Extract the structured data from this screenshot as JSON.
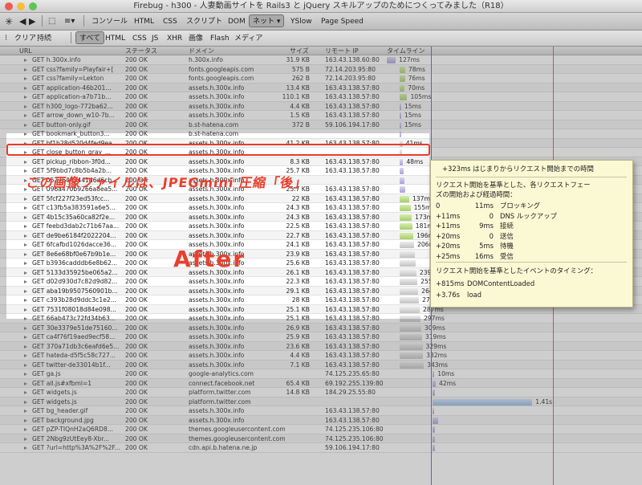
{
  "window": {
    "title": "Firebug - h300 - 人妻動画サイトを Rails3 と jQuery スキルアップのためにつくってみました（R18）"
  },
  "toolbar": {
    "tabs": [
      "コンソール",
      "HTML",
      "CSS",
      "スクリプト",
      "DOM",
      "ネット",
      "YSlow",
      "Page Speed"
    ],
    "net_dropdown": "▾",
    "clear": "クリア",
    "persist": "持続",
    "filters": [
      "すべて",
      "HTML",
      "CSS",
      "JS",
      "XHR",
      "画像",
      "Flash",
      "メディア"
    ]
  },
  "columns": {
    "url": "URL",
    "status": "ステータス",
    "domain": "ドメイン",
    "size": "サイズ",
    "remote_ip": "リモート IP",
    "timeline": "タイムライン"
  },
  "requests": [
    {
      "url": "GET h.300x.info",
      "status": "200 OK",
      "domain": "h.300x.info",
      "size": "31.9 KB",
      "ip": "163.43.138.60:80",
      "ms": "127ms",
      "bar_start": 0,
      "bar_len": 0.035,
      "color": "p"
    },
    {
      "url": "GET css?family=Playfair+[",
      "status": "200 OK",
      "domain": "fonts.googleapis.com",
      "size": "575 B",
      "ip": "72.14.203.95:80",
      "ms": "78ms",
      "bar_start": 0.05,
      "bar_len": 0.022,
      "color": "g"
    },
    {
      "url": "GET css?family=Lekton",
      "status": "200 OK",
      "domain": "fonts.googleapis.com",
      "size": "262 B",
      "ip": "72.14.203.95:80",
      "ms": "76ms",
      "bar_start": 0.05,
      "bar_len": 0.021,
      "color": "g"
    },
    {
      "url": "GET application-46b201...",
      "status": "200 OK",
      "domain": "assets.h.300x.info",
      "size": "13.4 KB",
      "ip": "163.43.138.57:80",
      "ms": "70ms",
      "bar_start": 0.05,
      "bar_len": 0.02,
      "color": "g"
    },
    {
      "url": "GET application-a7b71b...",
      "status": "200 OK",
      "domain": "assets.h.300x.info",
      "size": "110.1 KB",
      "ip": "163.43.138.57:80",
      "ms": "105ms",
      "bar_start": 0.05,
      "bar_len": 0.03,
      "color": "g"
    },
    {
      "url": "GET h300_logo-772ba62...",
      "status": "200 OK",
      "domain": "assets.h.300x.info",
      "size": "4.4 KB",
      "ip": "163.43.138.57:80",
      "ms": "15ms",
      "bar_start": 0.05,
      "bar_len": 0.004,
      "color": "p"
    },
    {
      "url": "GET arrow_down_w10-7b...",
      "status": "200 OK",
      "domain": "assets.h.300x.info",
      "size": "1.5 KB",
      "ip": "163.43.138.57:80",
      "ms": "15ms",
      "bar_start": 0.05,
      "bar_len": 0.004,
      "color": "p"
    },
    {
      "url": "GET button-only.gif",
      "status": "200 OK",
      "domain": "b.st-hatena.com",
      "size": "372 B",
      "ip": "59.106.194.17:80",
      "ms": "15ms",
      "bar_start": 0.05,
      "bar_len": 0.004,
      "color": "p"
    },
    {
      "url": "GET bookmark_button3...",
      "status": "200 OK",
      "domain": "b.st-hatena.com",
      "size": "",
      "ip": "",
      "ms": "",
      "bar_start": 0.05,
      "bar_len": 0.004,
      "color": "p"
    },
    {
      "url": "GET bf1b28d520d4fed9ea...",
      "status": "200 OK",
      "domain": "assets.h.300x.info",
      "size": "41.2 KB",
      "ip": "163.43.138.57:80",
      "ms": "41ms",
      "bar_start": 0.05,
      "bar_len": 0.012,
      "color": "s"
    },
    {
      "url": "GET close_button_gray_...",
      "status": "200 OK",
      "domain": "assets.h.300x.info",
      "size": "",
      "ip": "",
      "ms": "",
      "bar_start": 0.05,
      "bar_len": 0.01,
      "color": "s"
    },
    {
      "url": "GET pickup_ribbon-3f0d...",
      "status": "200 OK",
      "domain": "assets.h.300x.info",
      "size": "8.3 KB",
      "ip": "163.43.138.57:80",
      "ms": "48ms",
      "bar_start": 0.05,
      "bar_len": 0.014,
      "color": "p"
    },
    {
      "url": "GET 5f9bbd7c8b5b4a2b...",
      "status": "200 OK",
      "domain": "assets.h.300x.info",
      "size": "25.7 KB",
      "ip": "163.43.138.57:80",
      "ms": "",
      "bar_start": 0.05,
      "bar_len": 0.015,
      "color": "p"
    },
    {
      "url": "GET 05276443441d6d6cb...",
      "status": "200 OK",
      "domain": "assets.h.300x.info",
      "size": "",
      "ip": "",
      "ms": "",
      "bar_start": 0.05,
      "bar_len": 0.02,
      "color": "p"
    },
    {
      "url": "GET 096a470b9266a8ea5...",
      "status": "200 OK",
      "domain": "assets.h.300x.info",
      "size": "25.7 KB",
      "ip": "163.43.138.57:80",
      "ms": "",
      "bar_start": 0.05,
      "bar_len": 0.022,
      "color": "p"
    },
    {
      "url": "GET 5fcf227f23ed53fcc...",
      "status": "200 OK",
      "domain": "assets.h.300x.info",
      "size": "22 KB",
      "ip": "163.43.138.57:80",
      "ms": "137ms",
      "bar_start": 0.05,
      "bar_len": 0.038,
      "color": "g"
    },
    {
      "url": "GET c13fb5a383591a6e5...",
      "status": "200 OK",
      "domain": "assets.h.300x.info",
      "size": "24.3 KB",
      "ip": "163.43.138.57:80",
      "ms": "155ms",
      "bar_start": 0.05,
      "bar_len": 0.043,
      "color": "g"
    },
    {
      "url": "GET 4b15c35a60ca82f2e...",
      "status": "200 OK",
      "domain": "assets.h.300x.info",
      "size": "24.3 KB",
      "ip": "163.43.138.57:80",
      "ms": "173ms",
      "bar_start": 0.05,
      "bar_len": 0.048,
      "color": "g"
    },
    {
      "url": "GET feebd3dab2c71b67aa...",
      "status": "200 OK",
      "domain": "assets.h.300x.info",
      "size": "22.5 KB",
      "ip": "163.43.138.57:80",
      "ms": "181ms",
      "bar_start": 0.05,
      "bar_len": 0.05,
      "color": "g"
    },
    {
      "url": "GET de9be6184f2022204...",
      "status": "200 OK",
      "domain": "assets.h.300x.info",
      "size": "22.7 KB",
      "ip": "163.43.138.57:80",
      "ms": "196ms",
      "bar_start": 0.05,
      "bar_len": 0.054,
      "color": "g"
    },
    {
      "url": "GET 6fcafbd1026dacce36...",
      "status": "200 OK",
      "domain": "assets.h.300x.info",
      "size": "24.1 KB",
      "ip": "163.43.138.57:80",
      "ms": "206ms",
      "bar_start": 0.05,
      "bar_len": 0.057,
      "color": "s"
    },
    {
      "url": "GET 8e6e68bf0e67b9b1e...",
      "status": "200 OK",
      "domain": "assets.h.300x.info",
      "size": "23.9 KB",
      "ip": "163.43.138.57:80",
      "ms": "",
      "bar_start": 0.05,
      "bar_len": 0.06,
      "color": "s"
    },
    {
      "url": "GET b3936cadddb6e8b62...",
      "status": "200 OK",
      "domain": "assets.h.300x.info",
      "size": "25.6 KB",
      "ip": "163.43.138.57:80",
      "ms": "",
      "bar_start": 0.05,
      "bar_len": 0.062,
      "color": "s"
    },
    {
      "url": "GET 5133d35925be065a2...",
      "status": "200 OK",
      "domain": "assets.h.300x.info",
      "size": "26.1 KB",
      "ip": "163.43.138.57:80",
      "ms": "239ms",
      "bar_start": 0.05,
      "bar_len": 0.066,
      "color": "s"
    },
    {
      "url": "GET d02d930d7c82d9d82...",
      "status": "200 OK",
      "domain": "assets.h.300x.info",
      "size": "22.3 KB",
      "ip": "163.43.138.57:80",
      "ms": "255ms",
      "bar_start": 0.05,
      "bar_len": 0.07,
      "color": "s"
    },
    {
      "url": "GET aba19b9507560901b...",
      "status": "200 OK",
      "domain": "assets.h.300x.info",
      "size": "29.1 KB",
      "ip": "163.43.138.57:80",
      "ms": "264ms",
      "bar_start": 0.05,
      "bar_len": 0.073,
      "color": "s"
    },
    {
      "url": "GET c393b28d9ddc3c1e2...",
      "status": "200 OK",
      "domain": "assets.h.300x.info",
      "size": "28 KB",
      "ip": "163.43.138.57:80",
      "ms": "275ms",
      "bar_start": 0.05,
      "bar_len": 0.076,
      "color": "s"
    },
    {
      "url": "GET 7531f08018d84e098...",
      "status": "200 OK",
      "domain": "assets.h.300x.info",
      "size": "25.1 KB",
      "ip": "163.43.138.57:80",
      "ms": "287ms",
      "bar_start": 0.05,
      "bar_len": 0.079,
      "color": "s"
    },
    {
      "url": "GET 66ab473c72fd34b63...",
      "status": "200 OK",
      "domain": "assets.h.300x.info",
      "size": "25.1 KB",
      "ip": "163.43.138.57:80",
      "ms": "297ms",
      "bar_start": 0.05,
      "bar_len": 0.082,
      "color": "s"
    },
    {
      "url": "GET 30e3379e51de75160...",
      "status": "200 OK",
      "domain": "assets.h.300x.info",
      "size": "26.9 KB",
      "ip": "163.43.138.57:80",
      "ms": "309ms",
      "bar_start": 0.05,
      "bar_len": 0.085,
      "color": "s"
    },
    {
      "url": "GET ca4f76f19aed9ecf58...",
      "status": "200 OK",
      "domain": "assets.h.300x.info",
      "size": "25.9 KB",
      "ip": "163.43.138.57:80",
      "ms": "319ms",
      "bar_start": 0.05,
      "bar_len": 0.088,
      "color": "s"
    },
    {
      "url": "GET 370a71db3c6eafd6e5...",
      "status": "200 OK",
      "domain": "assets.h.300x.info",
      "size": "23.6 KB",
      "ip": "163.43.138.57:80",
      "ms": "329ms",
      "bar_start": 0.05,
      "bar_len": 0.09,
      "color": "s"
    },
    {
      "url": "GET hateda-d5f5c58c727...",
      "status": "200 OK",
      "domain": "assets.h.300x.info",
      "size": "4.4 KB",
      "ip": "163.43.138.57:80",
      "ms": "332ms",
      "bar_start": 0.05,
      "bar_len": 0.092,
      "color": "s"
    },
    {
      "url": "GET twitter-de33014b1f...",
      "status": "200 OK",
      "domain": "assets.h.300x.info",
      "size": "7.1 KB",
      "ip": "163.43.138.57:80",
      "ms": "343ms",
      "bar_start": 0.05,
      "bar_len": 0.095,
      "color": "s"
    },
    {
      "url": "GET ga.js",
      "status": "200 OK",
      "domain": "google-analytics.com",
      "size": "",
      "ip": "74.125.235.65:80",
      "ms": "10ms",
      "bar_start": 0.18,
      "bar_len": 0.003,
      "color": "p"
    },
    {
      "url": "GET all.js#xfbml=1",
      "status": "200 OK",
      "domain": "connect.facebook.net",
      "size": "65.4 KB",
      "ip": "69.192.255.139:80",
      "ms": "42ms",
      "bar_start": 0.18,
      "bar_len": 0.012,
      "color": "p"
    },
    {
      "url": "GET widgets.js",
      "status": "200 OK",
      "domain": "platform.twitter.com",
      "size": "14.8 KB",
      "ip": "184.29.25.55:80",
      "ms": "",
      "bar_start": 0.18,
      "bar_len": 0.01,
      "color": "p"
    },
    {
      "url": "GET widgets.js",
      "status": "200 OK",
      "domain": "platform.twitter.com",
      "size": "",
      "ip": "",
      "ms": "1.41s",
      "bar_start": 0.18,
      "bar_len": 0.39,
      "color": "b"
    },
    {
      "url": "GET bg_header.gif",
      "status": "200 OK",
      "domain": "assets.h.300x.info",
      "size": "",
      "ip": "163.43.138.57:80",
      "ms": "",
      "bar_start": 0.18,
      "bar_len": 0.005,
      "color": "p"
    },
    {
      "url": "GET background.jpg",
      "status": "200 OK",
      "domain": "assets.h.300x.info",
      "size": "",
      "ip": "163.43.138.57:80",
      "ms": "",
      "bar_start": 0.18,
      "bar_len": 0.02,
      "color": "p"
    },
    {
      "url": "GET pZP-TIQnH2aQ6RD8...",
      "status": "200 OK",
      "domain": "themes.googleusercontent.com",
      "size": "",
      "ip": "74.125.235.106:80",
      "ms": "",
      "bar_start": 0.18,
      "bar_len": 0.01,
      "color": "p"
    },
    {
      "url": "GET 2Nbg9zUtEey8-Xbr...",
      "status": "200 OK",
      "domain": "themes.googleusercontent.com",
      "size": "",
      "ip": "74.125.235.106:80",
      "ms": "",
      "bar_start": 0.18,
      "bar_len": 0.01,
      "color": "p"
    },
    {
      "url": "GET ?url=http%3A%2F%2F...",
      "status": "200 OK",
      "domain": "cdn.api.b.hatena.ne.jp",
      "size": "",
      "ip": "59.106.194.17:80",
      "ms": "",
      "bar_start": 0.18,
      "bar_len": 0.01,
      "color": "p"
    }
  ],
  "annotations": {
    "note": "この画像ファイルは、JPEGmini 圧縮「後」",
    "after": "After"
  },
  "tooltip": {
    "head": "+323ms  はじまりからリクエスト開始までの時間",
    "phase_title_1": "リクエスト開始を基準とした、各リクエストフェー",
    "phase_title_2": "ズの開始および経過時間：",
    "phases": [
      {
        "offset": "0",
        "dur": "11ms",
        "label": "ブロッキング"
      },
      {
        "offset": "+11ms",
        "dur": "0",
        "label": "DNS ルックアップ"
      },
      {
        "offset": "+11ms",
        "dur": "9ms",
        "label": "接続"
      },
      {
        "offset": "+20ms",
        "dur": "0",
        "label": "送信"
      },
      {
        "offset": "+20ms",
        "dur": "5ms",
        "label": "待機"
      },
      {
        "offset": "+25ms",
        "dur": "16ms",
        "label": "受信"
      }
    ],
    "event_title": "リクエスト開始を基準としたイベントのタイミング：",
    "events": [
      {
        "offset": "+815ms",
        "label": "DOMContentLoaded"
      },
      {
        "offset": "+3.76s",
        "label": "load"
      }
    ]
  }
}
